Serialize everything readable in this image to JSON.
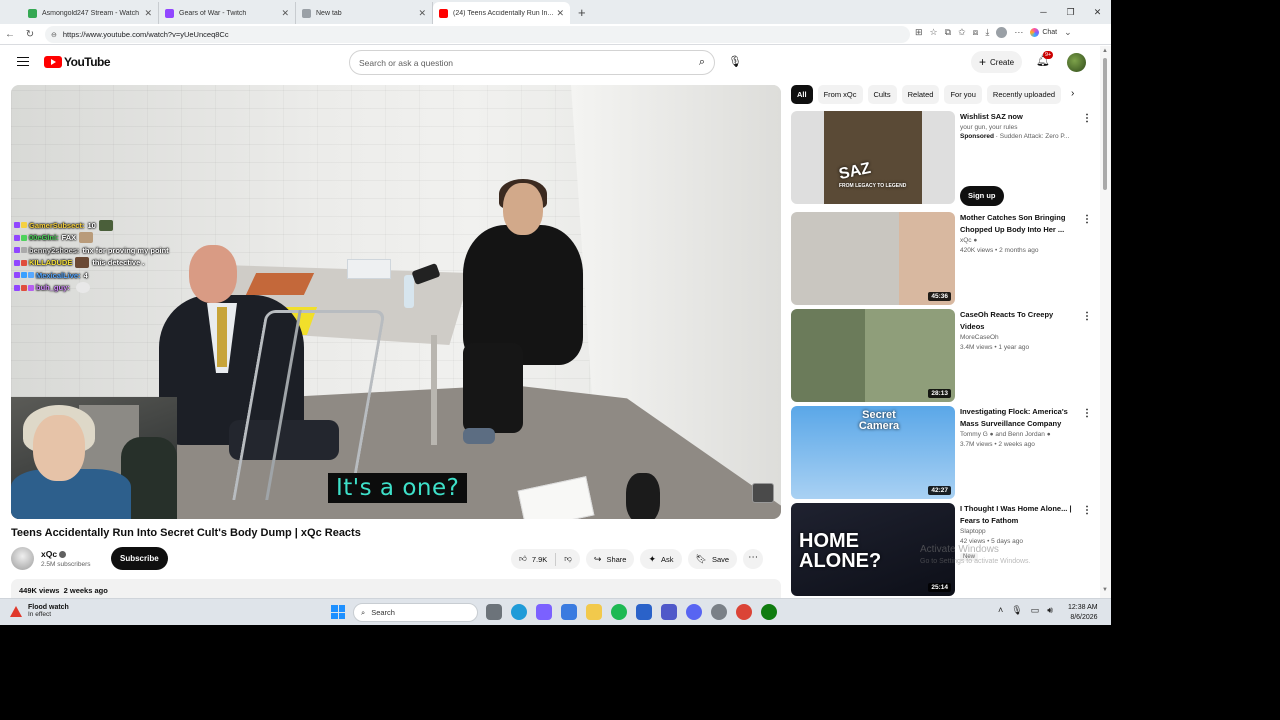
{
  "browser": {
    "tabs": [
      {
        "title": "Asmongold247 Stream - Watch L...",
        "favicon_color": "#35a853",
        "active": false
      },
      {
        "title": "Gears of War - Twitch",
        "favicon_color": "#9146ff",
        "active": false
      },
      {
        "title": "New tab",
        "favicon_color": "#9aa0a6",
        "active": false
      },
      {
        "title": "(24) Teens Accidentally Run In...",
        "favicon_color": "#ff0000",
        "active": true
      }
    ],
    "new_tab_symbol": "+",
    "url": "https://www.youtube.com/watch?v=yUeUnceq8Cc",
    "chat_button_label": "Chat"
  },
  "yt_header": {
    "logo_text": "YouTube",
    "search_placeholder": "Search or ask a question",
    "create_label": "Create",
    "notification_count": "9+"
  },
  "player": {
    "caption": "It's a one?",
    "chat_messages": [
      {
        "user": "GamerSubsect:",
        "message": "10",
        "color": "#f5d142"
      },
      {
        "user": "00eGlni:",
        "message": "FAX",
        "color": "#4ed35c"
      },
      {
        "user": "benny2shoes:",
        "message": "thx for proving my point",
        "color": "#c9c9c9"
      },
      {
        "user": "KILLADUDE",
        "message": "this detective .",
        "color": "#f4e03a"
      },
      {
        "user": "MexicalLive:",
        "message": "4",
        "color": "#57a8ff"
      },
      {
        "user": "buh_guy:",
        "message": "",
        "color": "#b65ff0"
      }
    ]
  },
  "video": {
    "title": "Teens Accidentally Run Into Secret Cult's Body Dump | xQc Reacts",
    "channel": "xQc",
    "subscribers": "2.5M subscribers",
    "subscribe_label": "Subscribe",
    "likes": "7.9K",
    "share_label": "Share",
    "ask_label": "Ask",
    "save_label": "Save",
    "views": "449K views",
    "age": "2 weeks ago"
  },
  "chips": [
    "All",
    "From xQc",
    "Cults",
    "Related",
    "For you",
    "Recently uploaded"
  ],
  "ad": {
    "title": "Wishlist SAZ now",
    "subtitle": "your gun, your rules",
    "sponsored_label": "Sponsored",
    "advertiser": "Sudden Attack: Zero P...",
    "cta": "Sign up",
    "thumb_text": "SAZ",
    "thumb_sub": "FROM LEGACY TO LEGEND"
  },
  "recommendations": [
    {
      "title": "Mother Catches Son Bringing Chopped Up Body Into Her ...",
      "channel": "xQc",
      "verified": true,
      "meta": "420K views • 2 months ago",
      "duration": "45:36"
    },
    {
      "title": "CaseOh Reacts To Creepy Videos",
      "channel": "MoreCaseOh",
      "verified": false,
      "meta": "3.4M views • 1 year ago",
      "duration": "28:13"
    },
    {
      "title": "Investigating Flock: America's Mass Surveillance Company",
      "channel": "Tommy G",
      "channel_extra": "and Benn Jordan",
      "verified": true,
      "meta": "3.7M views • 2 weeks ago",
      "duration": "42:27",
      "thumb_text": "Secret Camera"
    },
    {
      "title": "I Thought I Was Home Alone... | Fears to Fathom",
      "channel": "Slaptopp",
      "verified": false,
      "meta": "42 views • 5 days ago",
      "badge": "New",
      "duration": "25:14",
      "thumb_text": "HOME ALONE?"
    }
  ],
  "windows": {
    "activate_title": "Activate Windows",
    "activate_sub": "Go to Settings to activate Windows.",
    "weather_title": "Flood watch",
    "weather_sub": "In effect",
    "search_label": "Search",
    "time": "12:38 AM",
    "date": "8/6/2026"
  }
}
